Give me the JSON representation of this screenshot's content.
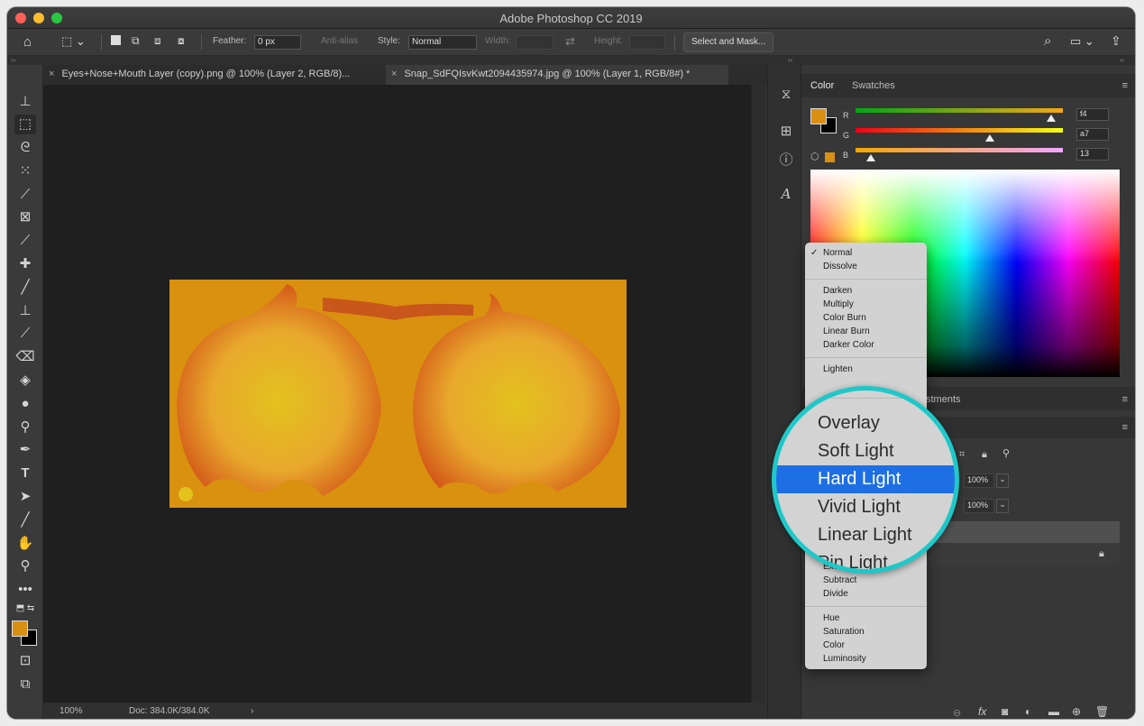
{
  "window": {
    "title": "Adobe Photoshop CC 2019"
  },
  "options": {
    "feather_label": "Feather:",
    "feather_value": "0 px",
    "antialias": "Anti-alias",
    "style_label": "Style:",
    "style_value": "Normal",
    "width_label": "Width:",
    "height_label": "Height:",
    "select_mask": "Select and Mask..."
  },
  "tabs": [
    {
      "label": "Eyes+Nose+Mouth Layer (copy).png @ 100% (Layer 2, RGB/8)..."
    },
    {
      "label": "Snap_SdFQIsvKwt2094435974.jpg @ 100% (Layer 1, RGB/8#) *"
    }
  ],
  "status": {
    "zoom": "100%",
    "doc": "Doc: 384.0K/384.0K"
  },
  "color_panel": {
    "tab_color": "Color",
    "tab_swatches": "Swatches",
    "r_label": "R",
    "g_label": "G",
    "b_label": "B",
    "r_value": "f4",
    "g_value": "a7",
    "b_value": "13",
    "fg_color": "#d98f12"
  },
  "layers": {
    "adjustments_tab": "stments",
    "opacity": "100%",
    "fill": "100%"
  },
  "blend_menu": {
    "groups": [
      [
        "Normal",
        "Dissolve"
      ],
      [
        "Darken",
        "Multiply",
        "Color Burn",
        "Linear Burn",
        "Darker Color"
      ],
      [
        "Lighten"
      ],
      [
        "Exclusion",
        "Subtract",
        "Divide"
      ],
      [
        "Hue",
        "Saturation",
        "Color",
        "Luminosity"
      ]
    ],
    "checked": "Normal"
  },
  "magnifier": {
    "items": [
      "Overlay",
      "Soft Light",
      "Hard Light",
      "Vivid Light",
      "Linear Light",
      "Pin Light"
    ],
    "selected": "Hard Light"
  },
  "colors": {
    "accent": "#1fc8c8",
    "selection": "#1e6fe3"
  }
}
